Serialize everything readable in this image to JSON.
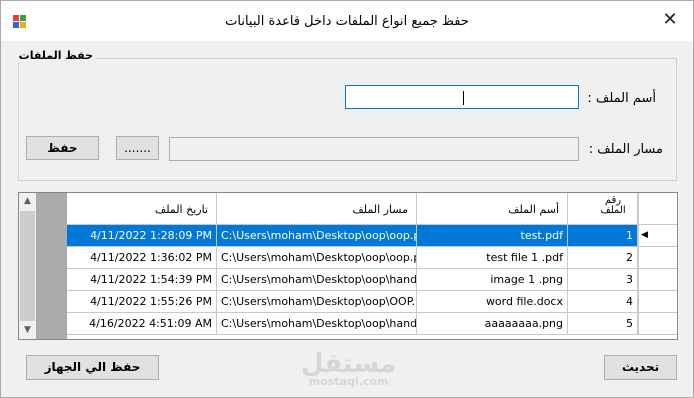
{
  "window": {
    "title": "حفظ جميع انواع الملفات داخل قاعدة البيانات",
    "close_glyph": "✕"
  },
  "group": {
    "legend": "حفظ الملفات",
    "file_name_label": "أسم الملف :",
    "file_name_value": "",
    "file_path_label": "مسار الملف :",
    "file_path_value": "",
    "browse_label": ".......",
    "save_label": "حفظ"
  },
  "grid": {
    "columns": {
      "number": "رقم الملف",
      "name": "أسم الملف",
      "path": "مسار الملف",
      "date": "تاريخ الملف"
    },
    "selected_row": 0,
    "rows": [
      {
        "number": "1",
        "name": "test.pdf",
        "path": "C:\\Users\\moham\\Desktop\\oop\\oop.pdf",
        "date": "4/11/2022 1:28:09 PM"
      },
      {
        "number": "2",
        "name": "test file 1 .pdf",
        "path": "C:\\Users\\moham\\Desktop\\oop\\oop.pdf",
        "date": "4/11/2022 1:36:02 PM"
      },
      {
        "number": "3",
        "name": "image 1 .png",
        "path": "C:\\Users\\moham\\Desktop\\oop\\hand-...",
        "date": "4/11/2022 1:54:39 PM"
      },
      {
        "number": "4",
        "name": "word file.docx",
        "path": "C:\\Users\\moham\\Desktop\\oop\\OOP....",
        "date": "4/11/2022 1:55:26 PM"
      },
      {
        "number": "5",
        "name": "aaaaaaaa.png",
        "path": "C:\\Users\\moham\\Desktop\\oop\\hand-...",
        "date": "4/16/2022 4:51:09 AM"
      }
    ]
  },
  "footer": {
    "save_to_device_label": "حفظ الي الجهاز",
    "refresh_label": "تحديث"
  },
  "watermark": {
    "arabic": "مستقل",
    "latin": "mostaql.com"
  },
  "colors": {
    "selection": "#0078d7",
    "focus_border": "#0078d7"
  }
}
